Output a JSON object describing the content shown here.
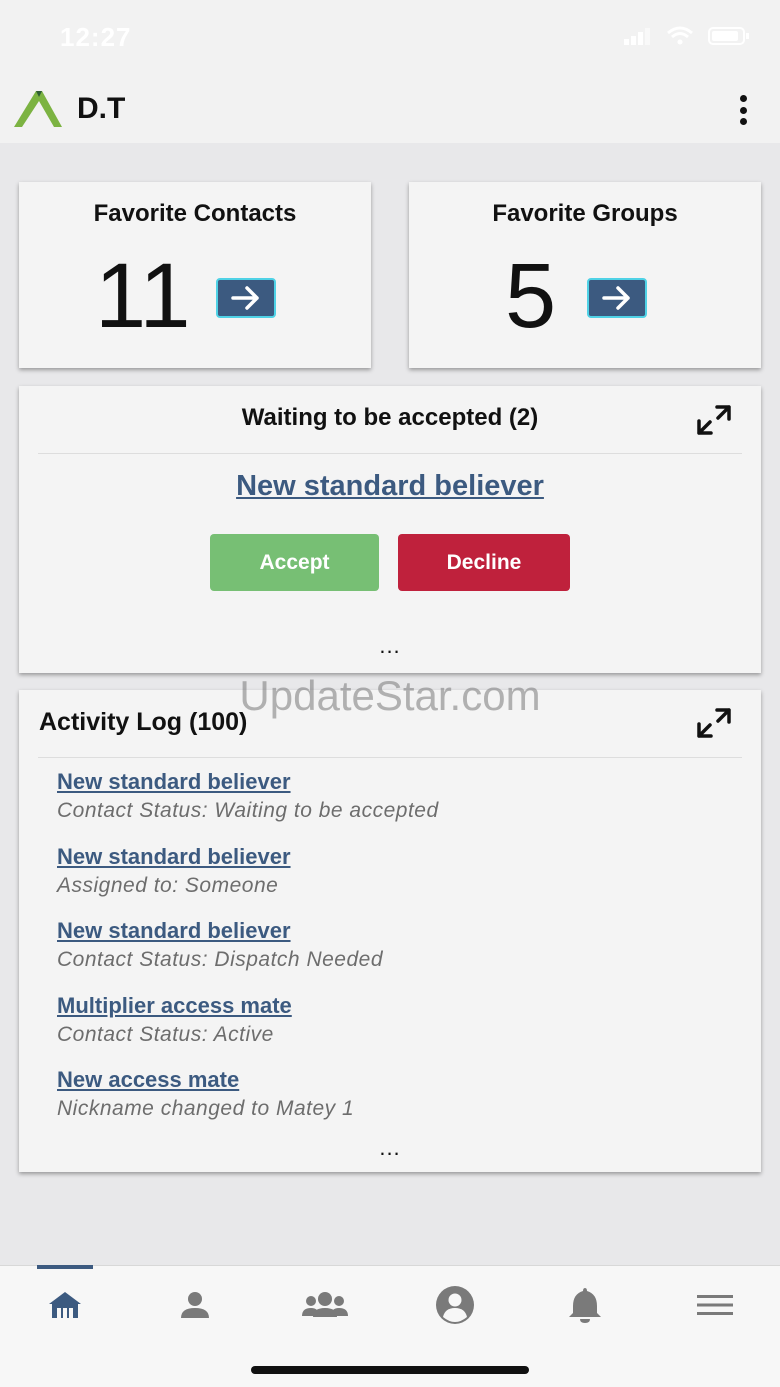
{
  "status_bar": {
    "time": "12:27"
  },
  "header": {
    "title": "D.T"
  },
  "favorites": {
    "contacts": {
      "title": "Favorite Contacts",
      "count": "11"
    },
    "groups": {
      "title": "Favorite Groups",
      "count": "5"
    }
  },
  "waiting": {
    "title": "Waiting to be accepted (2)",
    "contact_name": "New standard believer",
    "accept_label": "Accept",
    "decline_label": "Decline",
    "more": "..."
  },
  "activity": {
    "title": "Activity Log (100)",
    "items": [
      {
        "name": "New standard believer",
        "detail": "Contact Status: Waiting to be accepted"
      },
      {
        "name": "New standard believer",
        "detail": "Assigned to: Someone"
      },
      {
        "name": "New standard believer",
        "detail": "Contact Status: Dispatch Needed"
      },
      {
        "name": "Multiplier access mate",
        "detail": "Contact Status: Active"
      },
      {
        "name": "New access mate",
        "detail": "Nickname changed to Matey 1"
      }
    ],
    "more": "..."
  },
  "watermark": "UpdateStar.com",
  "tabs": [
    {
      "icon": "home-icon",
      "active": true
    },
    {
      "icon": "person-icon",
      "active": false
    },
    {
      "icon": "groups-icon",
      "active": false
    },
    {
      "icon": "account-circle-icon",
      "active": false
    },
    {
      "icon": "bell-icon",
      "active": false
    },
    {
      "icon": "menu-icon",
      "active": false
    }
  ],
  "colors": {
    "accent": "#3c5a80",
    "accept": "#77bf74",
    "decline": "#bf213c",
    "arrow_border": "#4fd2e6",
    "logo_green": "#7cb342"
  }
}
